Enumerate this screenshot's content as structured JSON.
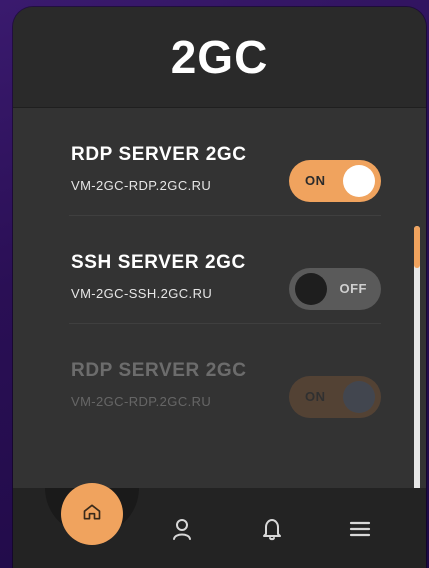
{
  "app": {
    "title": "2GC"
  },
  "servers": [
    {
      "name": "RDP SERVER 2GC",
      "host": "VM-2GC-RDP.2GC.RU",
      "toggle_label": "ON",
      "state": "on"
    },
    {
      "name": "SSH SERVER 2GC",
      "host": "VM-2GC-SSH.2GC.RU",
      "toggle_label": "OFF",
      "state": "off"
    },
    {
      "name": "RDP SERVER 2GC",
      "host": "VM-2GC-RDP.2GC.RU",
      "toggle_label": "ON",
      "state": "on",
      "faded": true
    }
  ],
  "nav": {
    "items": [
      {
        "icon": "home-icon",
        "active": true
      },
      {
        "icon": "user-icon",
        "active": false
      },
      {
        "icon": "bell-icon",
        "active": false
      },
      {
        "icon": "menu-icon",
        "active": false
      }
    ]
  },
  "colors": {
    "accent": "#f0a35e",
    "background": "#2f2f2f",
    "header": "#2a2a2a",
    "navbar": "#232323",
    "page_background": "#2a0f55"
  }
}
